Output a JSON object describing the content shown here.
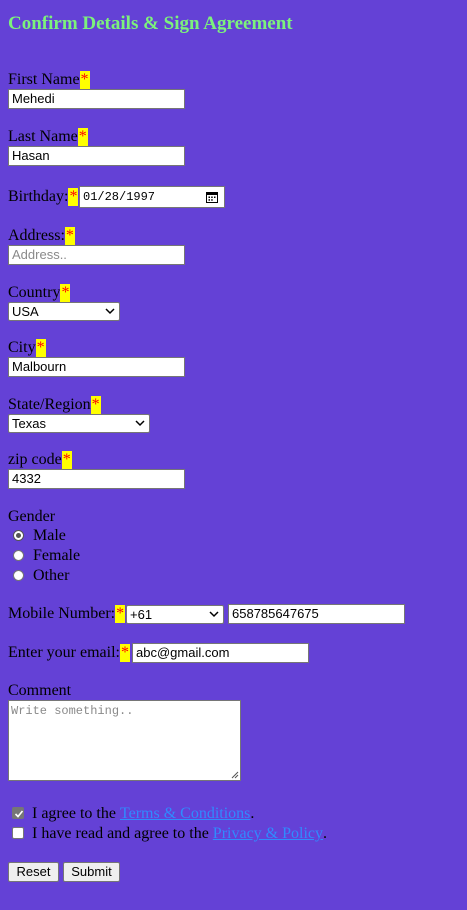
{
  "form": {
    "title": "Confirm Details & Sign Agreement",
    "required_mark": "*",
    "first_name": {
      "label": "First Name",
      "value": "Mehedi"
    },
    "last_name": {
      "label": "Last Name",
      "value": "Hasan"
    },
    "birthday": {
      "label": "Birthday:",
      "value": "01/28/1997",
      "icon": "calendar-icon"
    },
    "address": {
      "label": "Address:",
      "value": "",
      "placeholder": "Address.."
    },
    "country": {
      "label": "Country",
      "selected": "USA"
    },
    "city": {
      "label": "City",
      "value": "Malbourn"
    },
    "state": {
      "label": "State/Region",
      "selected": "Texas"
    },
    "zip": {
      "label": "zip code",
      "value": "4332"
    },
    "gender": {
      "label": "Gender",
      "options": [
        {
          "label": "Male",
          "checked": true
        },
        {
          "label": "Female",
          "checked": false
        },
        {
          "label": "Other",
          "checked": false
        }
      ]
    },
    "mobile": {
      "label": "Mobile Number:",
      "country_code": "+61",
      "value": "658785647675"
    },
    "email": {
      "label": "Enter your email:",
      "value": "abc@gmail.com"
    },
    "comment": {
      "label": "Comment",
      "placeholder": "Write something.."
    },
    "agreements": {
      "terms": {
        "prefix": "I agree to the",
        "link": "Terms & Conditions",
        "suffix": ".",
        "checked": true
      },
      "privacy": {
        "prefix": "I have read and agree to the",
        "link": "Privacy & Policy",
        "suffix": ".",
        "checked": false
      }
    },
    "buttons": {
      "reset": "Reset",
      "submit": "Submit"
    }
  },
  "colors": {
    "background": "#6441d6",
    "title": "#7cf27c",
    "required_bg": "#ffff00",
    "required_fg": "#ff0000",
    "link": "#2f8bff"
  }
}
